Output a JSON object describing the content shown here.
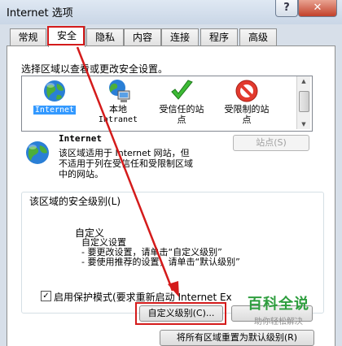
{
  "window": {
    "title": "Internet 选项",
    "help_label": "?",
    "close_label": "✕"
  },
  "tabs": [
    "常规",
    "安全",
    "隐私",
    "内容",
    "连接",
    "程序",
    "高级"
  ],
  "security": {
    "intro": "选择区域以查看或更改安全设置。",
    "zones": [
      {
        "label": "Internet",
        "icon": "globe-icon",
        "selected": true
      },
      {
        "label": "本地\nIntranet",
        "icon": "intranet-icon",
        "selected": false
      },
      {
        "label": "受信任的站\n点",
        "icon": "trusted-check-icon",
        "selected": false
      },
      {
        "label": "受限制的站\n点",
        "icon": "restricted-icon",
        "selected": false
      }
    ],
    "detail_title": "Internet",
    "detail_lines": [
      "该区域适用于 Internet 网站，但",
      "不适用于列在受信任和受限制区域",
      "中的网站。"
    ],
    "sites_button": "站点(S)",
    "level_legend": "该区域的安全级别(L)",
    "custom_title": "自定义",
    "custom_lines": [
      "自定义设置",
      "- 要更改设置，请单击“自定义级别”",
      "- 要使用推荐的设置，请单击“默认级别”"
    ],
    "protected_mode_label": "启用保护模式(要求重新启动 Internet Ex",
    "protected_mode_checked": true,
    "custom_level_button": "自定义级别(C)...",
    "reset_all_button": "将所有区域重置为默认级别(R)"
  },
  "watermark": {
    "title": "百科全说",
    "subtitle": "助你轻松解决"
  },
  "colors": {
    "highlight": "#d41b1b",
    "selection": "#3399ff",
    "watermark": "#2e9e3e"
  }
}
